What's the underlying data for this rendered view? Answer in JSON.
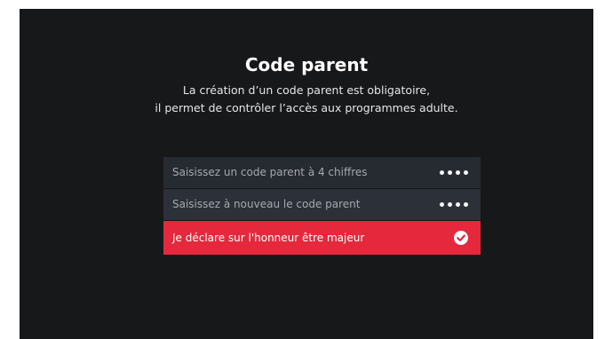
{
  "modal": {
    "title": "Code parent",
    "description_line1": "La création d’un code parent est obligatoire,",
    "description_line2": "il permet de contrôler l’accès aux programmes adulte."
  },
  "fields": [
    {
      "label": "Saisissez un code parent à 4 chiffres",
      "masked_length": 4
    },
    {
      "label": "Saisissez à nouveau le code parent",
      "masked_length": 4
    }
  ],
  "declaration": {
    "label": "Je déclare sur l'honneur être majeur",
    "checked": true,
    "icon": "check-circle-icon"
  },
  "colors": {
    "background": "#17181a",
    "field": "#262a31",
    "accent": "#e5283c"
  }
}
